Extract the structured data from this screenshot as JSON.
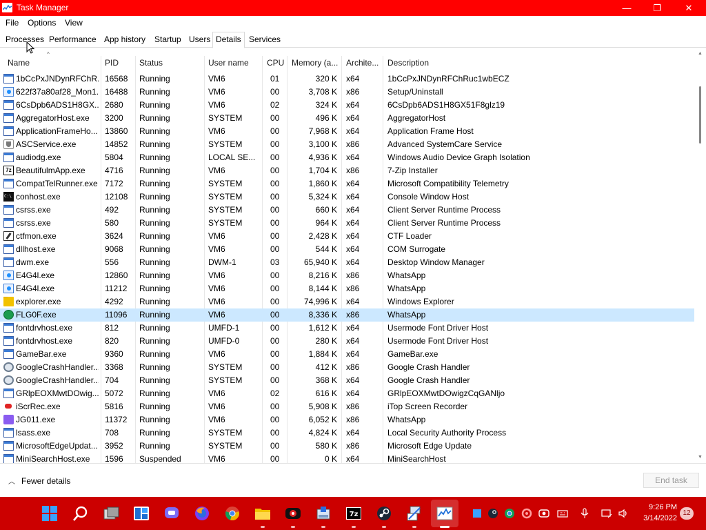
{
  "window": {
    "title": "Task Manager",
    "minimize_glyph": "—",
    "maximize_glyph": "❐",
    "close_glyph": "✕"
  },
  "menu": [
    "File",
    "Options",
    "View"
  ],
  "tabs": [
    {
      "label": "Processes",
      "active": false
    },
    {
      "label": "Performance",
      "active": false
    },
    {
      "label": "App history",
      "active": false
    },
    {
      "label": "Startup",
      "active": false
    },
    {
      "label": "Users",
      "active": false
    },
    {
      "label": "Details",
      "active": true
    },
    {
      "label": "Services",
      "active": false
    }
  ],
  "columns": {
    "name": "Name",
    "pid": "PID",
    "status": "Status",
    "user": "User name",
    "cpu": "CPU",
    "memory": "Memory (a...",
    "arch": "Archite...",
    "desc": "Description"
  },
  "processes": [
    {
      "icon": "window-icon",
      "name": "1bCcPxJNDynRFChR...",
      "pid": "16568",
      "status": "Running",
      "user": "VM6",
      "cpu": "01",
      "memory": "320 K",
      "arch": "x64",
      "desc": "1bCcPxJNDynRFChRuc1wbECZ"
    },
    {
      "icon": "installer-icon",
      "name": "622f37a80af28_Mon1...",
      "pid": "16488",
      "status": "Running",
      "user": "VM6",
      "cpu": "00",
      "memory": "3,708 K",
      "arch": "x86",
      "desc": "Setup/Uninstall"
    },
    {
      "icon": "window-icon",
      "name": "6CsDpb6ADS1H8GX...",
      "pid": "2680",
      "status": "Running",
      "user": "VM6",
      "cpu": "02",
      "memory": "324 K",
      "arch": "x64",
      "desc": "6CsDpb6ADS1H8GX51F8glz19"
    },
    {
      "icon": "window-icon",
      "name": "AggregatorHost.exe",
      "pid": "3200",
      "status": "Running",
      "user": "SYSTEM",
      "cpu": "00",
      "memory": "496 K",
      "arch": "x64",
      "desc": "AggregatorHost"
    },
    {
      "icon": "window-icon",
      "name": "ApplicationFrameHo...",
      "pid": "13860",
      "status": "Running",
      "user": "VM6",
      "cpu": "00",
      "memory": "7,968 K",
      "arch": "x64",
      "desc": "Application Frame Host"
    },
    {
      "icon": "shield-icon",
      "name": "ASCService.exe",
      "pid": "14852",
      "status": "Running",
      "user": "SYSTEM",
      "cpu": "00",
      "memory": "3,100 K",
      "arch": "x86",
      "desc": "Advanced SystemCare Service"
    },
    {
      "icon": "window-icon",
      "name": "audiodg.exe",
      "pid": "5804",
      "status": "Running",
      "user": "LOCAL SE...",
      "cpu": "00",
      "memory": "4,936 K",
      "arch": "x64",
      "desc": "Windows Audio Device Graph Isolation"
    },
    {
      "icon": "7zip-icon",
      "name": "BeautifulmApp.exe",
      "pid": "4716",
      "status": "Running",
      "user": "VM6",
      "cpu": "00",
      "memory": "1,704 K",
      "arch": "x86",
      "desc": "7-Zip Installer"
    },
    {
      "icon": "window-icon",
      "name": "CompatTelRunner.exe",
      "pid": "7172",
      "status": "Running",
      "user": "SYSTEM",
      "cpu": "00",
      "memory": "1,860 K",
      "arch": "x64",
      "desc": "Microsoft Compatibility Telemetry"
    },
    {
      "icon": "console-icon",
      "name": "conhost.exe",
      "pid": "12108",
      "status": "Running",
      "user": "SYSTEM",
      "cpu": "00",
      "memory": "5,324 K",
      "arch": "x64",
      "desc": "Console Window Host"
    },
    {
      "icon": "window-icon",
      "name": "csrss.exe",
      "pid": "492",
      "status": "Running",
      "user": "SYSTEM",
      "cpu": "00",
      "memory": "660 K",
      "arch": "x64",
      "desc": "Client Server Runtime Process"
    },
    {
      "icon": "window-icon",
      "name": "csrss.exe",
      "pid": "580",
      "status": "Running",
      "user": "SYSTEM",
      "cpu": "00",
      "memory": "964 K",
      "arch": "x64",
      "desc": "Client Server Runtime Process"
    },
    {
      "icon": "pen-icon",
      "name": "ctfmon.exe",
      "pid": "3624",
      "status": "Running",
      "user": "VM6",
      "cpu": "00",
      "memory": "2,428 K",
      "arch": "x64",
      "desc": "CTF Loader"
    },
    {
      "icon": "window-icon",
      "name": "dllhost.exe",
      "pid": "9068",
      "status": "Running",
      "user": "VM6",
      "cpu": "00",
      "memory": "544 K",
      "arch": "x64",
      "desc": "COM Surrogate"
    },
    {
      "icon": "window-icon",
      "name": "dwm.exe",
      "pid": "556",
      "status": "Running",
      "user": "DWM-1",
      "cpu": "03",
      "memory": "65,940 K",
      "arch": "x64",
      "desc": "Desktop Window Manager"
    },
    {
      "icon": "app-blue-icon",
      "name": "E4G4l.exe",
      "pid": "12860",
      "status": "Running",
      "user": "VM6",
      "cpu": "00",
      "memory": "8,216 K",
      "arch": "x86",
      "desc": "WhatsApp"
    },
    {
      "icon": "app-blue-icon",
      "name": "E4G4l.exe",
      "pid": "11212",
      "status": "Running",
      "user": "VM6",
      "cpu": "00",
      "memory": "8,144 K",
      "arch": "x86",
      "desc": "WhatsApp"
    },
    {
      "icon": "folder-icon",
      "name": "explorer.exe",
      "pid": "4292",
      "status": "Running",
      "user": "VM6",
      "cpu": "00",
      "memory": "74,996 K",
      "arch": "x64",
      "desc": "Windows Explorer"
    },
    {
      "icon": "green-app-icon",
      "name": "FLG0F.exe",
      "pid": "11096",
      "status": "Running",
      "user": "VM6",
      "cpu": "00",
      "memory": "8,336 K",
      "arch": "x86",
      "desc": "WhatsApp",
      "selected": true
    },
    {
      "icon": "window-icon",
      "name": "fontdrvhost.exe",
      "pid": "812",
      "status": "Running",
      "user": "UMFD-1",
      "cpu": "00",
      "memory": "1,612 K",
      "arch": "x64",
      "desc": "Usermode Font Driver Host"
    },
    {
      "icon": "window-icon",
      "name": "fontdrvhost.exe",
      "pid": "820",
      "status": "Running",
      "user": "UMFD-0",
      "cpu": "00",
      "memory": "280 K",
      "arch": "x64",
      "desc": "Usermode Font Driver Host"
    },
    {
      "icon": "window-icon",
      "name": "GameBar.exe",
      "pid": "9360",
      "status": "Running",
      "user": "VM6",
      "cpu": "00",
      "memory": "1,884 K",
      "arch": "x64",
      "desc": "GameBar.exe"
    },
    {
      "icon": "gear-icon",
      "name": "GoogleCrashHandler...",
      "pid": "3368",
      "status": "Running",
      "user": "SYSTEM",
      "cpu": "00",
      "memory": "412 K",
      "arch": "x86",
      "desc": "Google Crash Handler"
    },
    {
      "icon": "gear-icon",
      "name": "GoogleCrashHandler...",
      "pid": "704",
      "status": "Running",
      "user": "SYSTEM",
      "cpu": "00",
      "memory": "368 K",
      "arch": "x64",
      "desc": "Google Crash Handler"
    },
    {
      "icon": "window-icon",
      "name": "GRlpEOXMwtDOwig...",
      "pid": "5072",
      "status": "Running",
      "user": "VM6",
      "cpu": "02",
      "memory": "616 K",
      "arch": "x64",
      "desc": "GRlpEOXMwtDOwigzCqGANljo"
    },
    {
      "icon": "record-icon",
      "name": "iScrRec.exe",
      "pid": "5816",
      "status": "Running",
      "user": "VM6",
      "cpu": "00",
      "memory": "5,908 K",
      "arch": "x86",
      "desc": "iTop Screen Recorder"
    },
    {
      "icon": "tool-icon",
      "name": "JG011.exe",
      "pid": "11372",
      "status": "Running",
      "user": "VM6",
      "cpu": "00",
      "memory": "6,052 K",
      "arch": "x86",
      "desc": "WhatsApp"
    },
    {
      "icon": "window-icon",
      "name": "lsass.exe",
      "pid": "708",
      "status": "Running",
      "user": "SYSTEM",
      "cpu": "00",
      "memory": "4,824 K",
      "arch": "x64",
      "desc": "Local Security Authority Process"
    },
    {
      "icon": "window-icon",
      "name": "MicrosoftEdgeUpdat...",
      "pid": "3952",
      "status": "Running",
      "user": "SYSTEM",
      "cpu": "00",
      "memory": "580 K",
      "arch": "x86",
      "desc": "Microsoft Edge Update"
    },
    {
      "icon": "window-icon",
      "name": "MiniSearchHost.exe",
      "pid": "1596",
      "status": "Suspended",
      "user": "VM6",
      "cpu": "00",
      "memory": "0 K",
      "arch": "x64",
      "desc": "MiniSearchHost"
    }
  ],
  "footer": {
    "fewer_details": "Fewer details",
    "end_task": "End task"
  },
  "taskbar": {
    "apps": [
      "start-icon",
      "search-icon",
      "task-view-icon",
      "widgets-icon",
      "teams-chat-icon",
      "firefox-icon",
      "chrome-icon",
      "file-explorer-icon",
      "screen-recorder-icon",
      "installer-icon",
      "7zip-icon",
      "steam-icon",
      "network-tool-icon",
      "task-manager-icon"
    ],
    "time": "9:26 PM",
    "date": "3/14/2022",
    "notification_count": "12"
  },
  "colors": {
    "title_bar": "#ff0000",
    "taskbar": "#cc0000",
    "selected_row": "#cce8ff"
  }
}
